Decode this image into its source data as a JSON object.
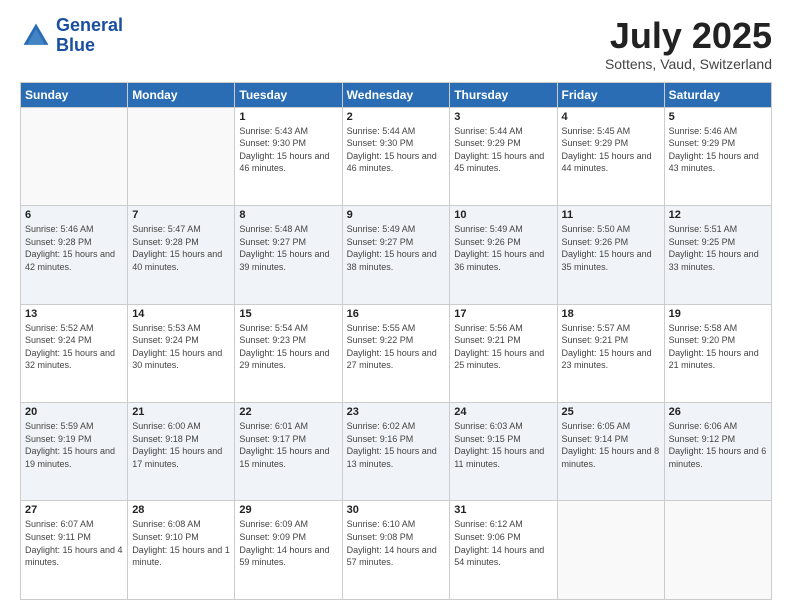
{
  "logo": {
    "line1": "General",
    "line2": "Blue"
  },
  "title": "July 2025",
  "location": "Sottens, Vaud, Switzerland",
  "days_of_week": [
    "Sunday",
    "Monday",
    "Tuesday",
    "Wednesday",
    "Thursday",
    "Friday",
    "Saturday"
  ],
  "weeks": [
    [
      {
        "day": "",
        "sunrise": "",
        "sunset": "",
        "daylight": ""
      },
      {
        "day": "",
        "sunrise": "",
        "sunset": "",
        "daylight": ""
      },
      {
        "day": "1",
        "sunrise": "Sunrise: 5:43 AM",
        "sunset": "Sunset: 9:30 PM",
        "daylight": "Daylight: 15 hours and 46 minutes."
      },
      {
        "day": "2",
        "sunrise": "Sunrise: 5:44 AM",
        "sunset": "Sunset: 9:30 PM",
        "daylight": "Daylight: 15 hours and 46 minutes."
      },
      {
        "day": "3",
        "sunrise": "Sunrise: 5:44 AM",
        "sunset": "Sunset: 9:29 PM",
        "daylight": "Daylight: 15 hours and 45 minutes."
      },
      {
        "day": "4",
        "sunrise": "Sunrise: 5:45 AM",
        "sunset": "Sunset: 9:29 PM",
        "daylight": "Daylight: 15 hours and 44 minutes."
      },
      {
        "day": "5",
        "sunrise": "Sunrise: 5:46 AM",
        "sunset": "Sunset: 9:29 PM",
        "daylight": "Daylight: 15 hours and 43 minutes."
      }
    ],
    [
      {
        "day": "6",
        "sunrise": "Sunrise: 5:46 AM",
        "sunset": "Sunset: 9:28 PM",
        "daylight": "Daylight: 15 hours and 42 minutes."
      },
      {
        "day": "7",
        "sunrise": "Sunrise: 5:47 AM",
        "sunset": "Sunset: 9:28 PM",
        "daylight": "Daylight: 15 hours and 40 minutes."
      },
      {
        "day": "8",
        "sunrise": "Sunrise: 5:48 AM",
        "sunset": "Sunset: 9:27 PM",
        "daylight": "Daylight: 15 hours and 39 minutes."
      },
      {
        "day": "9",
        "sunrise": "Sunrise: 5:49 AM",
        "sunset": "Sunset: 9:27 PM",
        "daylight": "Daylight: 15 hours and 38 minutes."
      },
      {
        "day": "10",
        "sunrise": "Sunrise: 5:49 AM",
        "sunset": "Sunset: 9:26 PM",
        "daylight": "Daylight: 15 hours and 36 minutes."
      },
      {
        "day": "11",
        "sunrise": "Sunrise: 5:50 AM",
        "sunset": "Sunset: 9:26 PM",
        "daylight": "Daylight: 15 hours and 35 minutes."
      },
      {
        "day": "12",
        "sunrise": "Sunrise: 5:51 AM",
        "sunset": "Sunset: 9:25 PM",
        "daylight": "Daylight: 15 hours and 33 minutes."
      }
    ],
    [
      {
        "day": "13",
        "sunrise": "Sunrise: 5:52 AM",
        "sunset": "Sunset: 9:24 PM",
        "daylight": "Daylight: 15 hours and 32 minutes."
      },
      {
        "day": "14",
        "sunrise": "Sunrise: 5:53 AM",
        "sunset": "Sunset: 9:24 PM",
        "daylight": "Daylight: 15 hours and 30 minutes."
      },
      {
        "day": "15",
        "sunrise": "Sunrise: 5:54 AM",
        "sunset": "Sunset: 9:23 PM",
        "daylight": "Daylight: 15 hours and 29 minutes."
      },
      {
        "day": "16",
        "sunrise": "Sunrise: 5:55 AM",
        "sunset": "Sunset: 9:22 PM",
        "daylight": "Daylight: 15 hours and 27 minutes."
      },
      {
        "day": "17",
        "sunrise": "Sunrise: 5:56 AM",
        "sunset": "Sunset: 9:21 PM",
        "daylight": "Daylight: 15 hours and 25 minutes."
      },
      {
        "day": "18",
        "sunrise": "Sunrise: 5:57 AM",
        "sunset": "Sunset: 9:21 PM",
        "daylight": "Daylight: 15 hours and 23 minutes."
      },
      {
        "day": "19",
        "sunrise": "Sunrise: 5:58 AM",
        "sunset": "Sunset: 9:20 PM",
        "daylight": "Daylight: 15 hours and 21 minutes."
      }
    ],
    [
      {
        "day": "20",
        "sunrise": "Sunrise: 5:59 AM",
        "sunset": "Sunset: 9:19 PM",
        "daylight": "Daylight: 15 hours and 19 minutes."
      },
      {
        "day": "21",
        "sunrise": "Sunrise: 6:00 AM",
        "sunset": "Sunset: 9:18 PM",
        "daylight": "Daylight: 15 hours and 17 minutes."
      },
      {
        "day": "22",
        "sunrise": "Sunrise: 6:01 AM",
        "sunset": "Sunset: 9:17 PM",
        "daylight": "Daylight: 15 hours and 15 minutes."
      },
      {
        "day": "23",
        "sunrise": "Sunrise: 6:02 AM",
        "sunset": "Sunset: 9:16 PM",
        "daylight": "Daylight: 15 hours and 13 minutes."
      },
      {
        "day": "24",
        "sunrise": "Sunrise: 6:03 AM",
        "sunset": "Sunset: 9:15 PM",
        "daylight": "Daylight: 15 hours and 11 minutes."
      },
      {
        "day": "25",
        "sunrise": "Sunrise: 6:05 AM",
        "sunset": "Sunset: 9:14 PM",
        "daylight": "Daylight: 15 hours and 8 minutes."
      },
      {
        "day": "26",
        "sunrise": "Sunrise: 6:06 AM",
        "sunset": "Sunset: 9:12 PM",
        "daylight": "Daylight: 15 hours and 6 minutes."
      }
    ],
    [
      {
        "day": "27",
        "sunrise": "Sunrise: 6:07 AM",
        "sunset": "Sunset: 9:11 PM",
        "daylight": "Daylight: 15 hours and 4 minutes."
      },
      {
        "day": "28",
        "sunrise": "Sunrise: 6:08 AM",
        "sunset": "Sunset: 9:10 PM",
        "daylight": "Daylight: 15 hours and 1 minute."
      },
      {
        "day": "29",
        "sunrise": "Sunrise: 6:09 AM",
        "sunset": "Sunset: 9:09 PM",
        "daylight": "Daylight: 14 hours and 59 minutes."
      },
      {
        "day": "30",
        "sunrise": "Sunrise: 6:10 AM",
        "sunset": "Sunset: 9:08 PM",
        "daylight": "Daylight: 14 hours and 57 minutes."
      },
      {
        "day": "31",
        "sunrise": "Sunrise: 6:12 AM",
        "sunset": "Sunset: 9:06 PM",
        "daylight": "Daylight: 14 hours and 54 minutes."
      },
      {
        "day": "",
        "sunrise": "",
        "sunset": "",
        "daylight": ""
      },
      {
        "day": "",
        "sunrise": "",
        "sunset": "",
        "daylight": ""
      }
    ]
  ]
}
